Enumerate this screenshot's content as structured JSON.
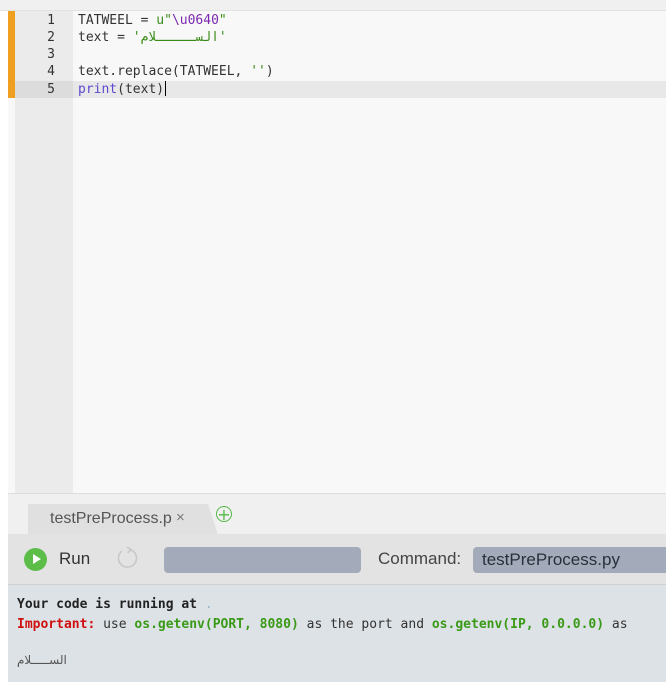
{
  "editor": {
    "line_numbers": [
      "1",
      "2",
      "3",
      "4",
      "5"
    ],
    "lines": [
      {
        "text": "TATWEEL = u\"\\u0640\""
      },
      {
        "text": "text = 'الســـــلام'"
      },
      {
        "text": ""
      },
      {
        "text": "text.replace(TATWEEL, '')"
      },
      {
        "text": "print(text)"
      }
    ],
    "line1": {
      "a": "TATWEEL = ",
      "b": "u\"",
      "c": "\\u0640",
      "d": "\""
    },
    "line2": {
      "a": "text = ",
      "b": "'الســـــلام'"
    },
    "line4": {
      "a": "text.replace(TATWEEL, ",
      "b": "''",
      "c": ")"
    },
    "line5": {
      "a": "print",
      "b": "(text)"
    }
  },
  "tabs": [
    {
      "label": "testPreProcess.py",
      "close": "×"
    }
  ],
  "add_tab": "+",
  "toolbar": {
    "run_label": "Run",
    "command_label": "Command:",
    "command_value": "testPreProcess.py"
  },
  "console": {
    "line1": "Your code is running at",
    "line1_suffix": ".",
    "important_label": "Important:",
    "t1": " use ",
    "port_call": "os.getenv(PORT, 8080)",
    "t2": " as the port and ",
    "ip_call": "os.getenv(IP, 0.0.0.0)",
    "t3": " as",
    "output": "الســـــلام"
  },
  "colors": {
    "run_green": "#5cbd48",
    "modified_marker": "#f0a020",
    "important_red": "#d01010"
  }
}
